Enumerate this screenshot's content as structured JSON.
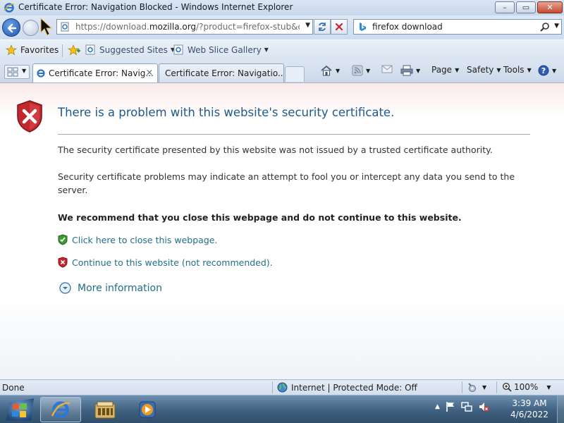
{
  "window": {
    "title": "Certificate Error: Navigation Blocked - Windows Internet Explorer",
    "buttons": {
      "minimize": "–",
      "maximize": "▭",
      "close": "✕"
    }
  },
  "navigation": {
    "address_prefix": "https://download.",
    "address_domain": "mozilla.org",
    "address_suffix": "/?product=firefox-stub&os=wi",
    "search_query": "firefox download"
  },
  "favorites_bar": {
    "favorites_label": "Favorites",
    "suggested_sites_label": "Suggested Sites",
    "web_slice_gallery_label": "Web Slice Gallery"
  },
  "tabs": [
    {
      "label": "Certificate Error: Navig...",
      "active": true
    },
    {
      "label": "Certificate Error: Navigatio...",
      "active": false
    }
  ],
  "command_bar": {
    "page_label": "Page",
    "safety_label": "Safety",
    "tools_label": "Tools"
  },
  "page": {
    "heading": "There is a problem with this website's security certificate.",
    "paragraph_1": "The security certificate presented by this website was not issued by a trusted certificate authority.",
    "paragraph_2": "Security certificate problems may indicate an attempt to fool you or intercept any data you send to the server.",
    "recommendation": "We recommend that you close this webpage and do not continue to this website.",
    "close_link": "Click here to close this webpage.",
    "continue_link": "Continue to this website (not recommended).",
    "more_info": "More information"
  },
  "status_bar": {
    "status": "Done",
    "zone": "Internet | Protected Mode: Off",
    "zoom": "100%"
  },
  "taskbar": {
    "time": "3:39 AM",
    "date": "4/6/2022"
  },
  "colors": {
    "link": "#1f6e8a",
    "heading": "#1f5a8c",
    "error_red": "#c0282d",
    "safe_green": "#3c9b2f"
  }
}
